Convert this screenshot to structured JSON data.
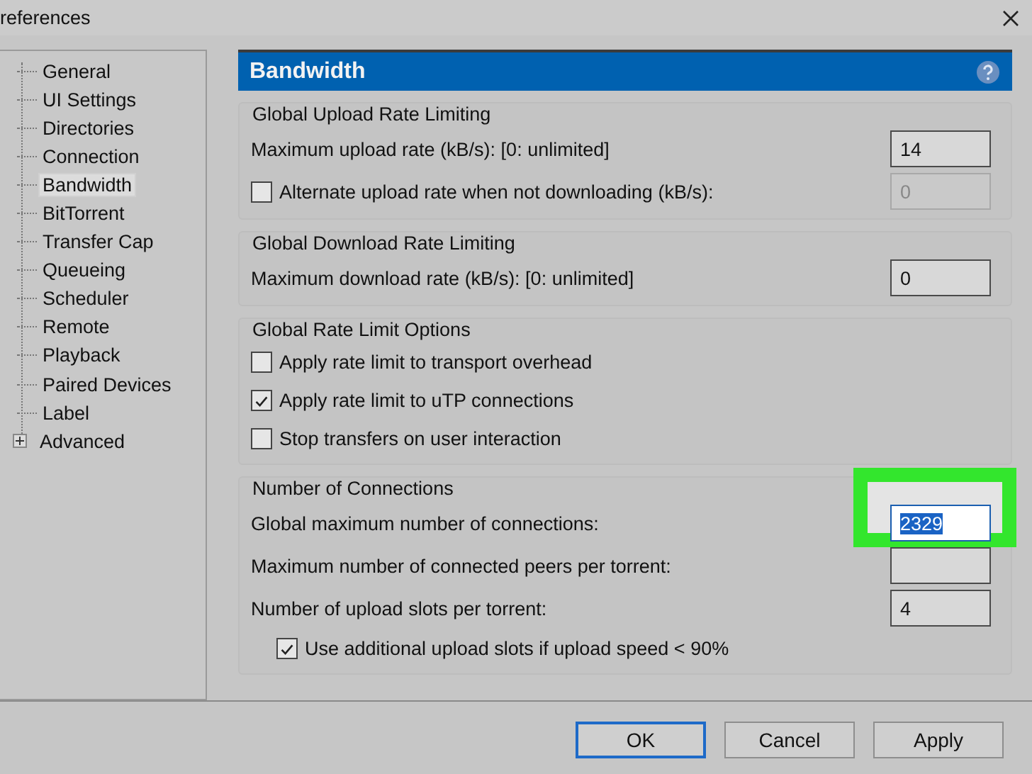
{
  "window": {
    "title": "references"
  },
  "sidebar": {
    "items": [
      {
        "label": "General",
        "selected": false,
        "kind": "leaf"
      },
      {
        "label": "UI Settings",
        "selected": false,
        "kind": "leaf"
      },
      {
        "label": "Directories",
        "selected": false,
        "kind": "leaf"
      },
      {
        "label": "Connection",
        "selected": false,
        "kind": "leaf"
      },
      {
        "label": "Bandwidth",
        "selected": true,
        "kind": "leaf"
      },
      {
        "label": "BitTorrent",
        "selected": false,
        "kind": "leaf"
      },
      {
        "label": "Transfer Cap",
        "selected": false,
        "kind": "leaf"
      },
      {
        "label": "Queueing",
        "selected": false,
        "kind": "leaf"
      },
      {
        "label": "Scheduler",
        "selected": false,
        "kind": "leaf"
      },
      {
        "label": "Remote",
        "selected": false,
        "kind": "leaf"
      },
      {
        "label": "Playback",
        "selected": false,
        "kind": "leaf"
      },
      {
        "label": "Paired Devices",
        "selected": false,
        "kind": "leaf"
      },
      {
        "label": "Label",
        "selected": false,
        "kind": "leaf"
      },
      {
        "label": "Advanced",
        "selected": false,
        "kind": "collapsed"
      }
    ]
  },
  "panel": {
    "title": "Bandwidth",
    "groups": [
      {
        "title": "Global Upload Rate Limiting",
        "rows": [
          {
            "kind": "field",
            "label": "Maximum upload rate (kB/s): [0: unlimited]",
            "value": "14",
            "disabled": false,
            "text_selected": false,
            "highlighted": false
          },
          {
            "kind": "check-field",
            "label": "Alternate upload rate when not downloading (kB/s):",
            "checked": false,
            "value": "0",
            "disabled": true,
            "text_selected": false,
            "highlighted": false
          }
        ]
      },
      {
        "title": "Global Download Rate Limiting",
        "rows": [
          {
            "kind": "field",
            "label": "Maximum download rate (kB/s): [0: unlimited]",
            "value": "0",
            "disabled": false,
            "text_selected": false,
            "highlighted": false
          }
        ]
      },
      {
        "title": "Global Rate Limit Options",
        "rows": [
          {
            "kind": "check",
            "label": "Apply rate limit to transport overhead",
            "checked": false
          },
          {
            "kind": "check",
            "label": "Apply rate limit to uTP connections",
            "checked": true
          },
          {
            "kind": "check",
            "label": "Stop transfers on user interaction",
            "checked": false
          }
        ]
      },
      {
        "title": "Number of Connections",
        "rows": [
          {
            "kind": "field",
            "label": "Global maximum number of connections:",
            "value": "2329",
            "disabled": false,
            "text_selected": true,
            "highlighted": true
          },
          {
            "kind": "field",
            "label": "Maximum number of connected peers per torrent:",
            "disabled": false,
            "text_selected": false,
            "highlighted": false
          },
          {
            "kind": "field",
            "label": "Number of upload slots per torrent:",
            "value": "4",
            "disabled": false,
            "text_selected": false,
            "highlighted": false
          },
          {
            "kind": "sub-check",
            "label": "Use additional upload slots if upload speed < 90%",
            "checked": true
          }
        ]
      }
    ]
  },
  "buttons": [
    {
      "label": "OK",
      "default": true
    },
    {
      "label": "Cancel",
      "default": false
    },
    {
      "label": "Apply",
      "default": false
    }
  ]
}
